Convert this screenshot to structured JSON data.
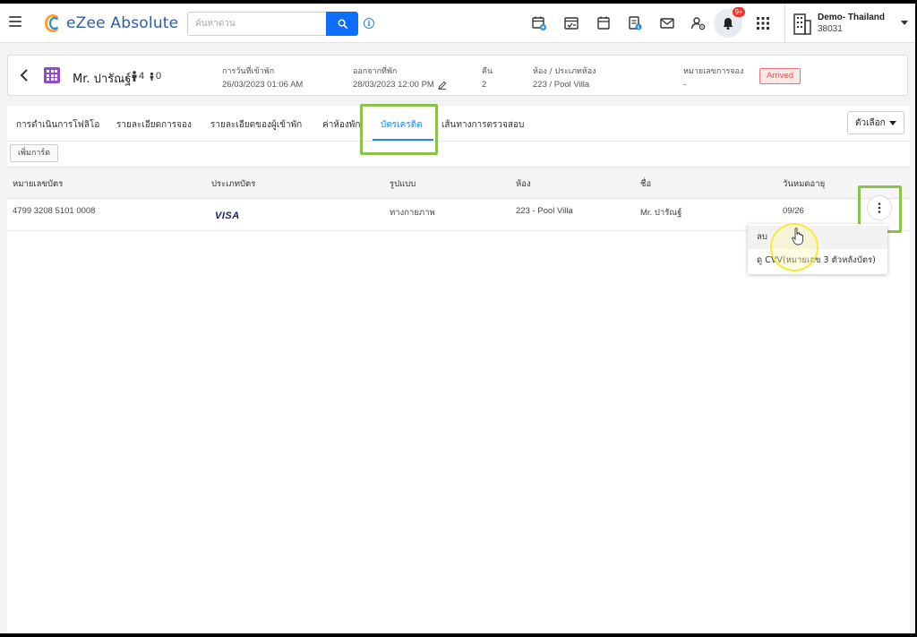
{
  "app": {
    "logo_text": "eZee Absolute",
    "search_placeholder": "ค้นหาด่วน",
    "notification_count": "9+",
    "property_name": "Demo- Thailand",
    "property_code": "38031",
    "colors": {
      "primary": "#1e88e5",
      "search_button": "#0d6efd",
      "highlight": "#8bc34a",
      "badge_red": "#e53935"
    },
    "toolbar_icons": [
      "calendar-add-icon",
      "checklist-icon",
      "calendar-icon",
      "invoice-icon",
      "mail-icon",
      "user-settings-icon",
      "bell-icon",
      "apps-grid-icon"
    ]
  },
  "guest": {
    "name": "Mr. ปารัณฐ์",
    "adults": "4",
    "children": "0",
    "checkin_label": "การวันที่เข้าพัก",
    "checkin_value": "26/03/2023 01:06 AM",
    "checkout_label": "ออกจากที่พัก",
    "checkout_value": "28/03/2023 12:00 PM",
    "nights_label": "คืน",
    "nights_value": "2",
    "room_label": "ห้อง / ประเภทห้อง",
    "room_value": "223 / Pool Villa",
    "booking_label": "หมายเลขการจอง",
    "booking_value": "-",
    "status": "Arrived"
  },
  "tabs": [
    {
      "label": "การดำเนินการโฟลิโอ"
    },
    {
      "label": "รายละเอียดการจอง"
    },
    {
      "label": "รายละเอียดของผู้เข้าพัก"
    },
    {
      "label": "ค่าห้องพัก"
    },
    {
      "label": "บัตรเครดิต",
      "active": true
    },
    {
      "label": "เส้นทางการตรวจสอบ"
    }
  ],
  "options_label": "ตัวเลือก",
  "add_card_label": "เพิ่มการ์ด",
  "table": {
    "headers": [
      "หมายเลขบัตร",
      "ประเภทบัตร",
      "รูปแบบ",
      "ห้อง",
      "ชื่อ",
      "วันหมดอายุ"
    ],
    "rows": [
      {
        "card_number": "4799 3208 5101 0008",
        "card_type": "VISA",
        "mode": "ทางกายภาพ",
        "room": "223 - Pool Villa",
        "name": "Mr. ปารัณฐ์",
        "expiry": "09/26"
      }
    ]
  },
  "row_menu": {
    "items": [
      "ลบ",
      "ดู CVV(หมายเลข 3 ตัวหลังบัตร)"
    ]
  }
}
